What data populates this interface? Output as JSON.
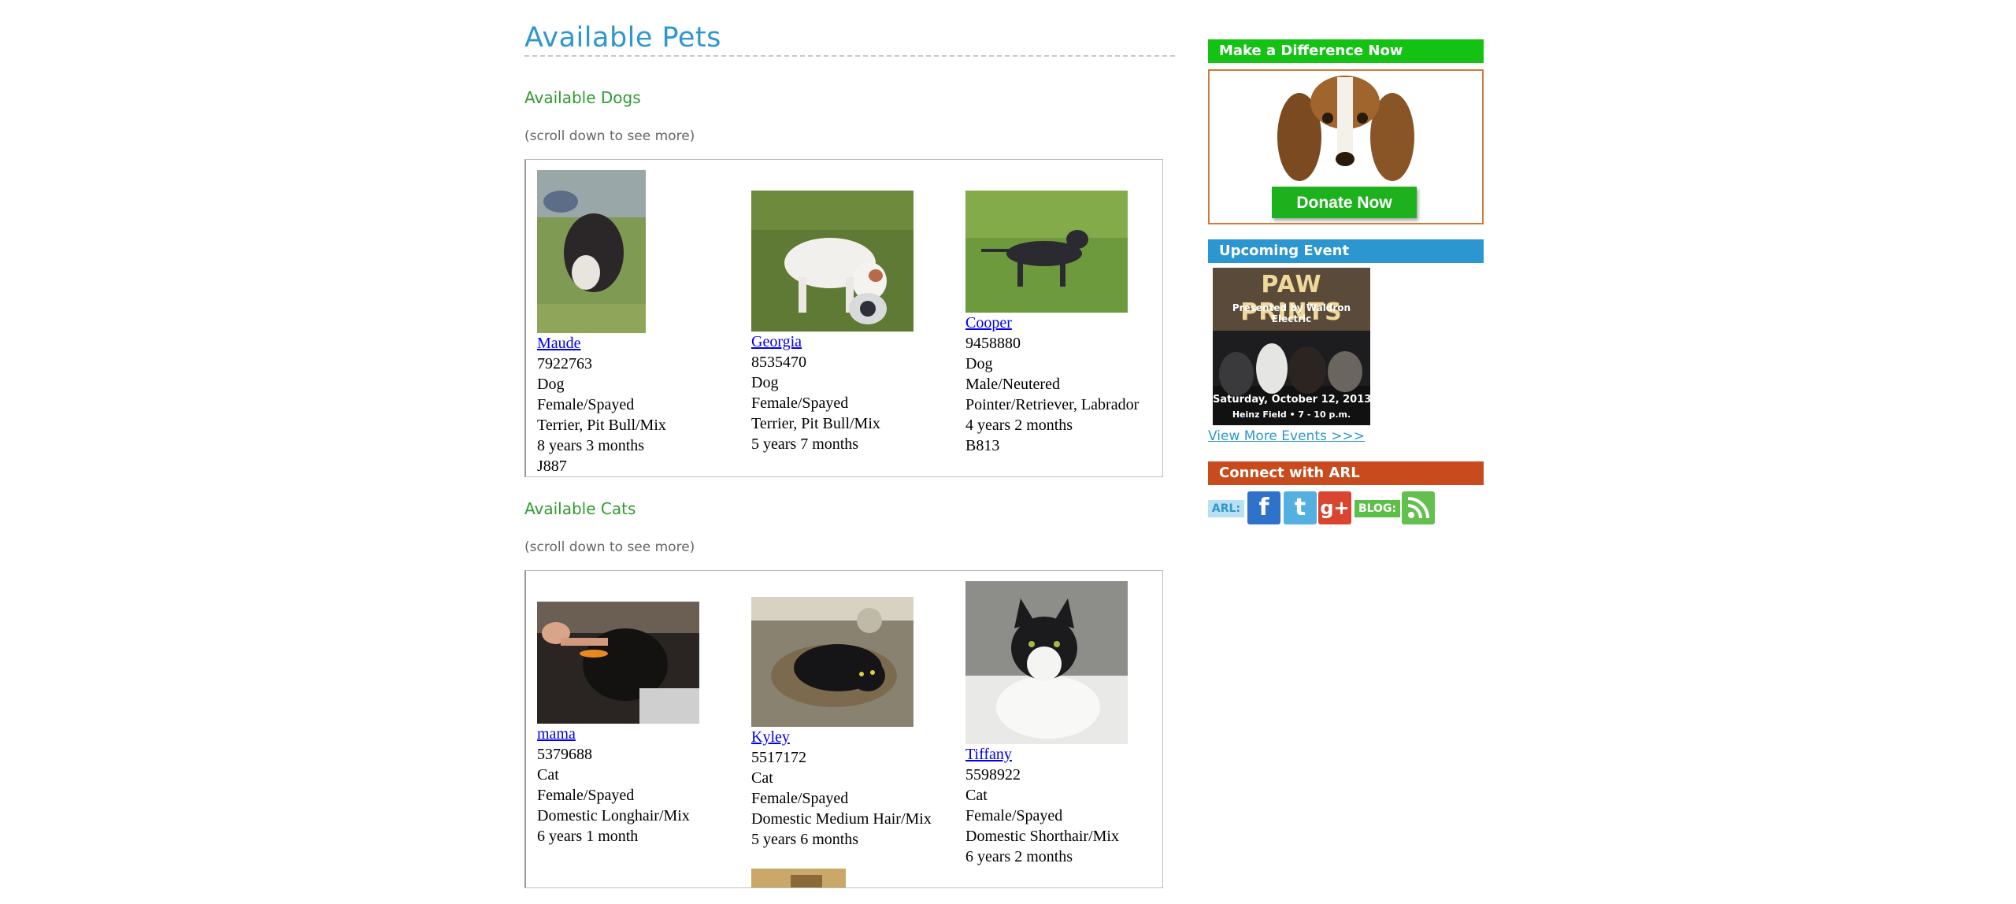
{
  "page": {
    "title": "Available Pets"
  },
  "dogs": {
    "heading": "Available Dogs",
    "scroll_note": "(scroll down to see more)",
    "pets": [
      {
        "name": "Maude",
        "id": "7922763",
        "species": "Dog",
        "sex": "Female/Spayed",
        "breed": "Terrier, Pit Bull/Mix",
        "age": "8 years 3 months",
        "kennel": "J887"
      },
      {
        "name": "Georgia",
        "id": "8535470",
        "species": "Dog",
        "sex": "Female/Spayed",
        "breed": "Terrier, Pit Bull/Mix",
        "age": "5 years 7 months"
      },
      {
        "name": "Cooper",
        "id": "9458880",
        "species": "Dog",
        "sex": "Male/Neutered",
        "breed": "Pointer/Retriever, Labrador",
        "age": "4 years 2 months",
        "kennel": "B813"
      }
    ]
  },
  "cats": {
    "heading": "Available Cats",
    "scroll_note": "(scroll down to see more)",
    "pets": [
      {
        "name": "mama",
        "id": "5379688",
        "species": "Cat",
        "sex": "Female/Spayed",
        "breed": "Domestic Longhair/Mix",
        "age": "6 years 1 month"
      },
      {
        "name": "Kyley",
        "id": "5517172",
        "species": "Cat",
        "sex": "Female/Spayed",
        "breed": "Domestic Medium Hair/Mix",
        "age": "5 years 6 months"
      },
      {
        "name": "Tiffany",
        "id": "5598922",
        "species": "Cat",
        "sex": "Female/Spayed",
        "breed": "Domestic Shorthair/Mix",
        "age": "6 years 2 months"
      }
    ]
  },
  "sidebar": {
    "donate": {
      "header": "Make a Difference Now",
      "button": "Donate Now"
    },
    "event": {
      "header": "Upcoming Event",
      "poster_title": "PAW PRINTS",
      "poster_sponsor": "Presented by Waldron Electric",
      "poster_date": "Saturday, October 12, 2013",
      "poster_venue": "Heinz Field • 7 - 10 p.m.",
      "more_link": "View More Events >>>"
    },
    "connect": {
      "header": "Connect with ARL",
      "arl_label": "ARL:",
      "blog_label": "BLOG:",
      "icons": [
        "facebook-icon",
        "twitter-icon",
        "google-plus-icon",
        "rss-icon"
      ]
    }
  },
  "colors": {
    "title_blue": "#2e97cc",
    "section_green": "#2f9b2f",
    "donate_bar": "#14c214",
    "event_bar": "#2b96d0",
    "connect_bar": "#c84b1d",
    "link_blue": "#0000ee"
  }
}
